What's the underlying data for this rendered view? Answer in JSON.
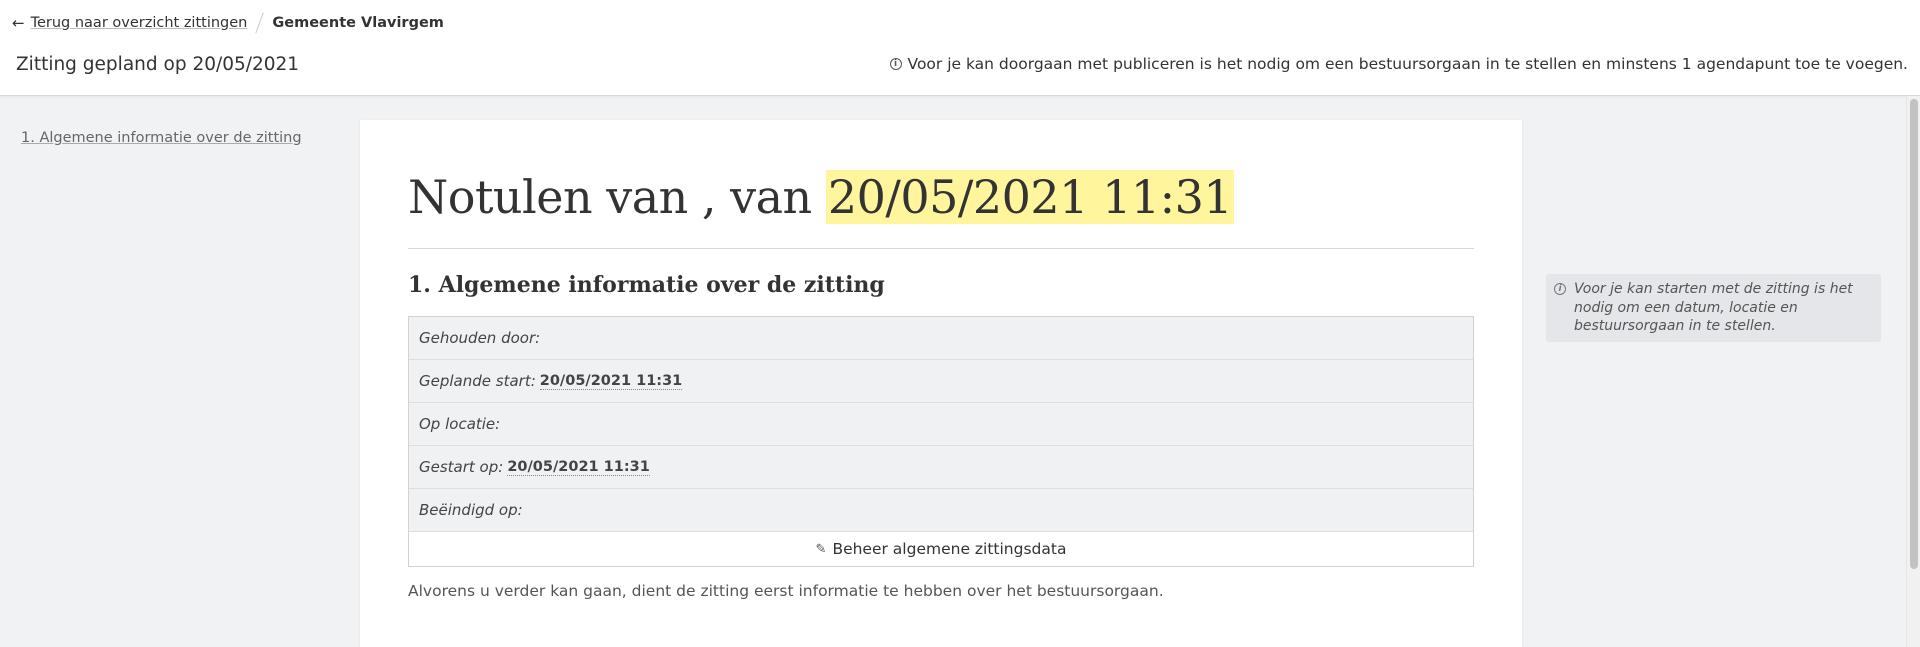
{
  "header": {
    "back_arrow": "←",
    "back_label": "Terug naar overzicht zittingen",
    "municipality": "Gemeente Vlavirgem",
    "session_title": "Zitting gepland op 20/05/2021",
    "publish_note": "Voor je kan doorgaan met publiceren is het nodig om een bestuursorgaan in te stellen en minstens 1 agendapunt toe te voegen."
  },
  "toc": {
    "items": [
      {
        "label": "1. Algemene informatie over de zitting"
      }
    ]
  },
  "document": {
    "title_prefix": "Notulen van , van ",
    "title_date": "20/05/2021 11:31",
    "section_heading": "1. Algemene informatie over de zitting",
    "rows": [
      {
        "label": "Gehouden door:",
        "value": ""
      },
      {
        "label": "Geplande start:",
        "value": "20/05/2021 11:31"
      },
      {
        "label": "Op locatie:",
        "value": ""
      },
      {
        "label": "Gestart op:",
        "value": "20/05/2021 11:31"
      },
      {
        "label": "Beëindigd op:",
        "value": ""
      }
    ],
    "manage_button": "Beheer algemene zittingsdata",
    "note": "Alvorens u verder kan gaan, dient de zitting eerst informatie te hebben over het bestuursorgaan."
  },
  "hint": {
    "text": "Voor je kan starten met de zitting is het nodig om een datum, locatie en bestuursorgaan in te stellen."
  },
  "icons": {
    "info": "info-circle-icon",
    "pencil": "pencil-icon",
    "back": "arrow-left-icon"
  },
  "colors": {
    "highlight": "#fff59d",
    "background": "#f1f2f4",
    "table_bg": "#f0f1f3"
  }
}
